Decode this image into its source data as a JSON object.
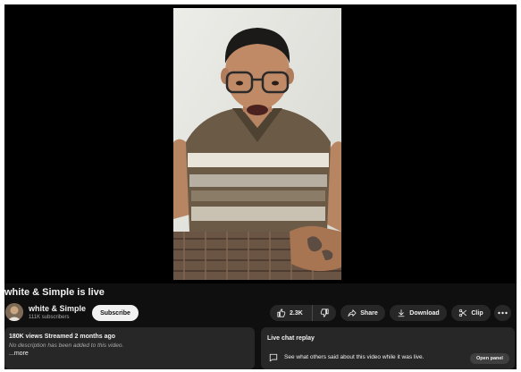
{
  "video": {
    "title": "white & Simple is live"
  },
  "channel": {
    "name": "white & Simple",
    "subscribers": "111K subscribers",
    "subscribe_label": "Subscribe"
  },
  "actions": {
    "like_count": "2.3K",
    "share_label": "Share",
    "download_label": "Download",
    "clip_label": "Clip",
    "more_icon": "more-horizontal-icon"
  },
  "description": {
    "meta": "180K views  Streamed 2 months ago",
    "text": "No description has been added to this video.",
    "more_label": "...more"
  },
  "chat_replay": {
    "title": "Live chat replay",
    "text": "See what others said about this video while it was live.",
    "open_label": "Open panel"
  },
  "colors": {
    "background": "#0f0f0f",
    "surface": "#272727",
    "text_primary": "#f1f1f1",
    "text_secondary": "#aaaaaa",
    "subscribe_bg": "#f1f1f1"
  }
}
